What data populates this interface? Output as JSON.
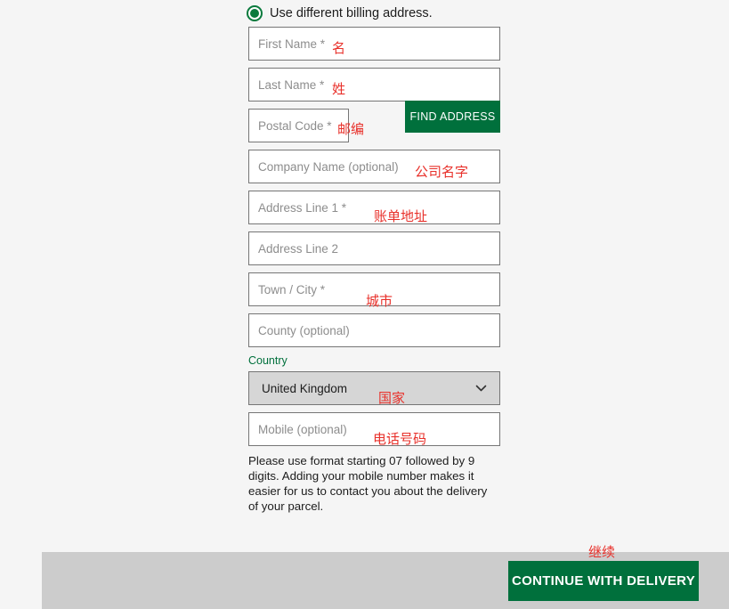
{
  "page": {
    "background": "#f5f5f5",
    "brand_green": "#00703c",
    "annotation_color": "#e8302a"
  },
  "billing": {
    "radio": {
      "label": "Use different billing address.",
      "selected": true,
      "icon": "radio-selected-icon"
    },
    "fields": [
      {
        "name": "first-name",
        "placeholder": "First Name *"
      },
      {
        "name": "last-name",
        "placeholder": "Last Name *"
      },
      {
        "name": "postal-code",
        "placeholder": "Postal Code *"
      },
      {
        "name": "company-name",
        "placeholder": "Company Name (optional)"
      },
      {
        "name": "address-1",
        "placeholder": "Address Line 1 *"
      },
      {
        "name": "address-2",
        "placeholder": "Address Line 2"
      },
      {
        "name": "town-city",
        "placeholder": "Town / City *"
      },
      {
        "name": "county",
        "placeholder": "County (optional)"
      },
      {
        "name": "mobile",
        "placeholder": "Mobile (optional)"
      }
    ],
    "find_address_button": "FIND ADDRESS",
    "country": {
      "label": "Country",
      "value": "United Kingdom",
      "chevron_icon": "chevron-down-icon"
    },
    "mobile_help": "Please use format starting 07 followed by 9 digits. Adding your mobile number makes it easier for us to contact you about the delivery of your parcel."
  },
  "footer": {
    "continue_button": "CONTINUE WITH DELIVERY"
  },
  "annotations": {
    "first_name": "名",
    "last_name": "姓",
    "postal_code": "邮编",
    "company_name": "公司名字",
    "address_1": "账单地址",
    "town_city": "城市",
    "country": "国家",
    "mobile": "电话号码",
    "continue": "继续"
  }
}
